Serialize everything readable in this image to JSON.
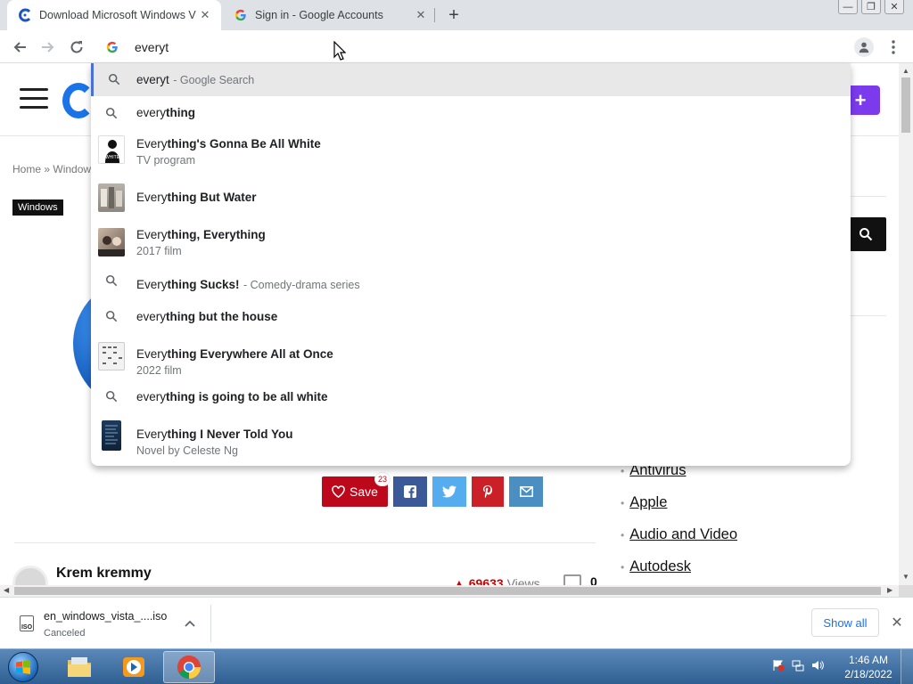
{
  "tabs": [
    {
      "title": "Download Microsoft Windows V",
      "icon": "site-c-icon",
      "active": true
    },
    {
      "title": "Sign in - Google Accounts",
      "icon": "google-g-icon",
      "active": false
    }
  ],
  "omnibox": {
    "value": "everyt"
  },
  "suggestions": [
    {
      "kind": "search",
      "typed": "everyt",
      "rest": "",
      "desc": "- Google Search"
    },
    {
      "kind": "search",
      "typed": "every",
      "rest": "thing",
      "desc": ""
    },
    {
      "kind": "entity",
      "typed": "Every",
      "rest": "thing's Gonna Be All White",
      "sub": "TV program"
    },
    {
      "kind": "entity",
      "typed": "Every",
      "rest": "thing But Water",
      "sub": ""
    },
    {
      "kind": "entity",
      "typed": "Every",
      "rest": "thing, Everything",
      "sub": "2017 film"
    },
    {
      "kind": "search",
      "typed": "Every",
      "rest": "thing Sucks!",
      "desc": "- Comedy-drama series"
    },
    {
      "kind": "search",
      "typed": "every",
      "rest": "thing but the house",
      "desc": ""
    },
    {
      "kind": "entity",
      "typed": "Every",
      "rest": "thing Everywhere All at Once",
      "sub": "2022 film"
    },
    {
      "kind": "search",
      "typed": "every",
      "rest": "thing is going to be all white",
      "desc": ""
    },
    {
      "kind": "entity",
      "typed": "Every",
      "rest": "thing I Never Told You",
      "sub": "Novel by Celeste Ng"
    }
  ],
  "page": {
    "breadcrumb_home": "Home",
    "breadcrumb_sep": "»",
    "breadcrumb_section": "Window",
    "category_badge": "Windows",
    "save_label": "Save",
    "save_count": "23",
    "author": "Krem kremmy",
    "views_count": "69633",
    "views_label": "Views",
    "comments_count": "0",
    "categories": [
      "Antivirus",
      "Apple",
      "Audio and Video",
      "Autodesk"
    ]
  },
  "downloads": {
    "file_name": "en_windows_vista_....iso",
    "status": "Canceled",
    "icon_text": "ISO",
    "show_all": "Show all"
  },
  "taskbar": {
    "time": "1:46 AM",
    "date": "2/18/2022"
  },
  "colors": {
    "accent": "#1a73e8",
    "save_red": "#bd081c",
    "plus_purple": "#7c3aed"
  }
}
